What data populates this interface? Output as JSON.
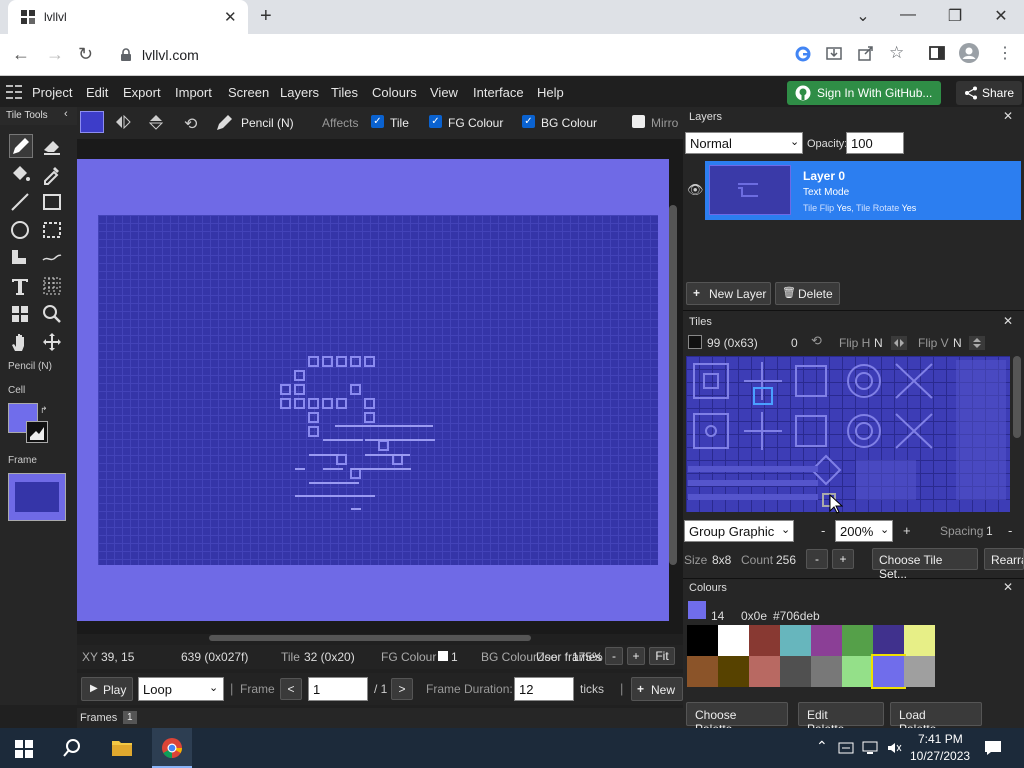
{
  "browser": {
    "tab_title": "lvllvl",
    "url": "lvllvl.com",
    "new_tab": "+",
    "tab_close": "✕"
  },
  "menubar": {
    "items": [
      "Project",
      "Edit",
      "Export",
      "Import",
      "Screen",
      "Layers",
      "Tiles",
      "Colours",
      "View",
      "Interface",
      "Help"
    ],
    "github_button": "Sign In With GitHub...",
    "share_button": "Share"
  },
  "tool_tools": {
    "title": "Tile Tools",
    "current_tool": "Pencil (N)",
    "cell_label": "Cell",
    "frame_label": "Frame"
  },
  "toolbar": {
    "tool_name": "Pencil (N)",
    "affects_label": "Affects",
    "tile_label": "Tile",
    "fg_label": "FG Colour",
    "bg_label": "BG Colour",
    "mirror_label": "Mirro"
  },
  "status": {
    "xy_label": "XY",
    "xy_value": "39, 15",
    "index_value": "639 (0x027f)",
    "tile_label": "Tile",
    "tile_value": "32 (0x20)",
    "fg_label": "FG Colour",
    "fg_value": "1",
    "bg_label": "BG Colour",
    "bg_overlap": "Zoo",
    "user_frames": "User frames",
    "zoom_value": "175%",
    "minus": "-",
    "plus": "+",
    "fit": "Fit"
  },
  "playback": {
    "play": "Play",
    "loop_option": "Loop",
    "frame_label": "Frame",
    "prev": "<",
    "frame_value": "1",
    "frame_total": "/ 1",
    "next": ">",
    "duration_label": "Frame Duration:",
    "duration_value": "12",
    "ticks": "ticks",
    "new_button": "New",
    "sep": "|"
  },
  "frames": {
    "label": "Frames",
    "count": "1"
  },
  "layers": {
    "title": "Layers",
    "blend_mode": "Normal",
    "opacity_label": "Opacity:",
    "opacity_value": "100",
    "layer_name": "Layer 0",
    "layer_mode": "Text Mode",
    "flip_label": "Tile Flip",
    "flip_value": "Yes",
    "rotate_label": ", Tile Rotate",
    "rotate_value": "Yes",
    "new_layer": "New Layer",
    "delete": "Delete"
  },
  "tiles": {
    "title": "Tiles",
    "tile_index": "99 (0x63)",
    "tile_rot": "0",
    "flip_h_label": "Flip H",
    "flip_h_value": "N",
    "flip_v_label": "Flip V",
    "flip_v_value": "N",
    "group_select": "Group Graphic",
    "zoom_minus": "-",
    "zoom_select": "200%",
    "zoom_plus": "+",
    "spacing_label": "Spacing",
    "spacing_value": "1",
    "spacing_minus": "-",
    "size_label": "Size",
    "size_value": "8x8",
    "count_label": "Count",
    "count_value": "256",
    "count_minus": "-",
    "count_plus": "+",
    "choose_set": "Choose Tile Set...",
    "rearrange": "Rearra"
  },
  "colours": {
    "title": "Colours",
    "index": "14",
    "hex_index": "0x0e",
    "hex_value": "#706deb",
    "palette": [
      "#000000",
      "#ffffff",
      "#883932",
      "#67b6bd",
      "#8b3f96",
      "#55a049",
      "#40318d",
      "#e7ef87",
      "#8b5429",
      "#574200",
      "#b86962",
      "#505050",
      "#787878",
      "#94e089",
      "#706deb",
      "#9f9f9f"
    ],
    "choose_palette": "Choose Palette...",
    "edit_palette": "Edit Palette...",
    "load_palette": "Load Palette..."
  },
  "taskbar": {
    "time": "7:41 PM",
    "date": "10/27/2023"
  },
  "colors": {
    "accent": "#2c7ef0",
    "canvas_bg": "#6f6ae6",
    "grid_bg": "#3535a8",
    "github_green": "#2f8d46"
  }
}
